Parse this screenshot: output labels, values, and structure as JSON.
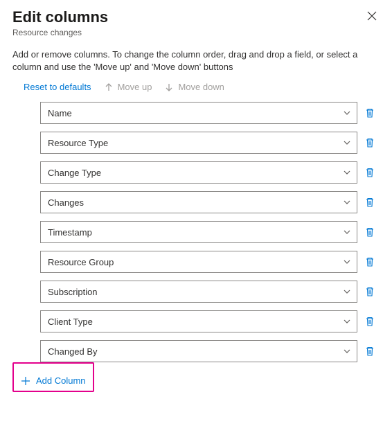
{
  "header": {
    "title": "Edit columns",
    "subtitle": "Resource changes"
  },
  "description": "Add or remove columns. To change the column order, drag and drop a field, or select a column and use the 'Move up' and 'Move down' buttons",
  "actions": {
    "reset": "Reset to defaults",
    "move_up": "Move up",
    "move_down": "Move down"
  },
  "columns": [
    {
      "label": "Name"
    },
    {
      "label": "Resource Type"
    },
    {
      "label": "Change Type"
    },
    {
      "label": "Changes"
    },
    {
      "label": "Timestamp"
    },
    {
      "label": "Resource Group"
    },
    {
      "label": "Subscription"
    },
    {
      "label": "Client Type"
    },
    {
      "label": "Changed By"
    }
  ],
  "add_column_label": "Add Column"
}
